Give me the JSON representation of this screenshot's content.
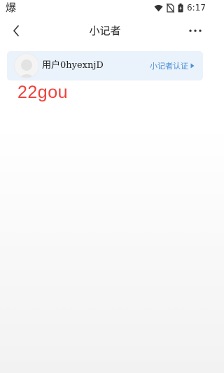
{
  "status_bar": {
    "app_glyph": "爆",
    "time": "6:17"
  },
  "nav": {
    "title": "小记者",
    "back_icon": "chevron-left-icon",
    "more_icon": "more-horizontal-icon"
  },
  "user_card": {
    "username": "用户0hyexnjD",
    "verify_label": "小记者认证",
    "background": "#eaf2fb",
    "accent": "#4a8fd6"
  },
  "caption": {
    "text": "22gou",
    "color": "#f0413b"
  }
}
